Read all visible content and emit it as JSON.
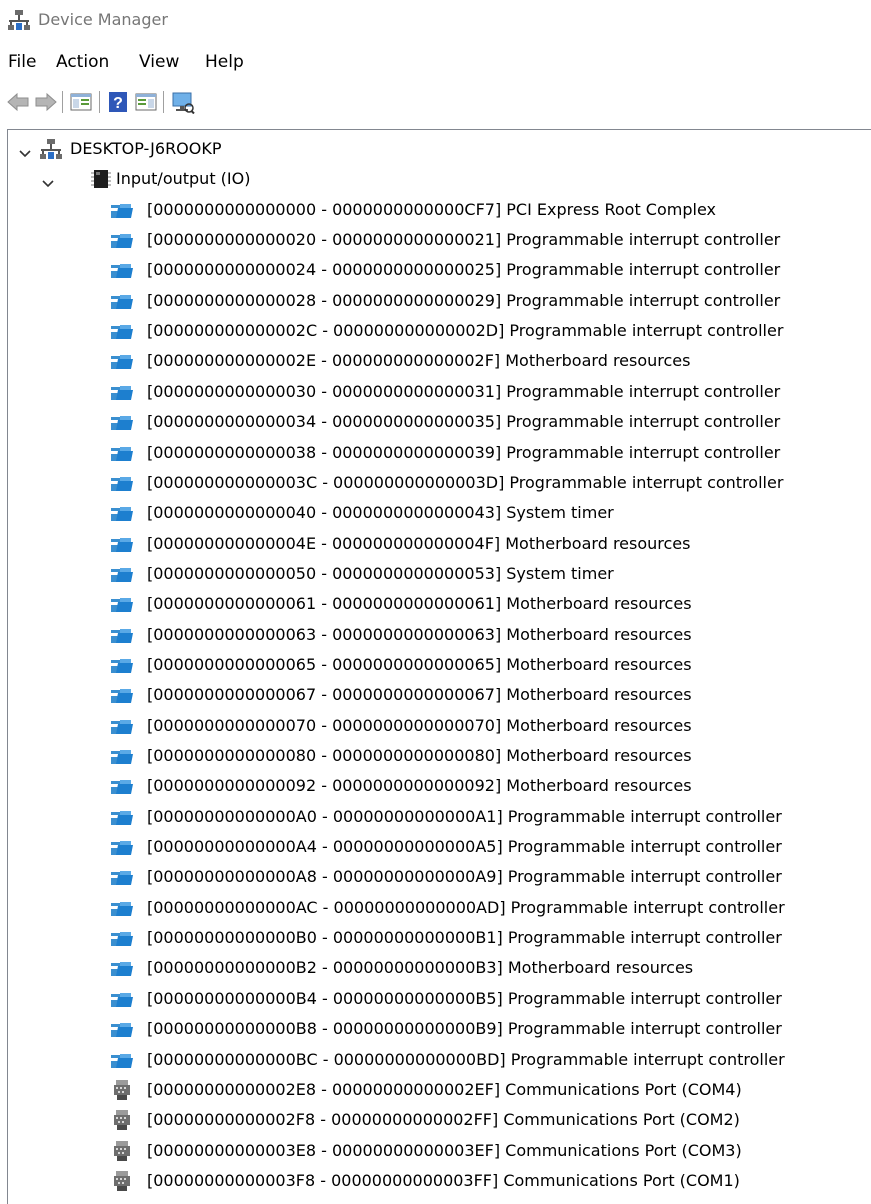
{
  "window": {
    "title": "Device Manager"
  },
  "menu": [
    "File",
    "Action",
    "View",
    "Help"
  ],
  "toolbar": [
    "back-icon",
    "forward-icon",
    "show-hide-console-tree-icon",
    "help-icon",
    "properties-icon",
    "scan-hardware-icon"
  ],
  "tree": {
    "root": {
      "label": "DESKTOP-J6ROOKP",
      "icon": "computer-icon",
      "expanded": true
    },
    "category": {
      "label": "Input/output (IO)",
      "icon": "io-chip-icon",
      "expanded": true
    },
    "items": [
      {
        "label": "[0000000000000000 - 0000000000000CF7]  PCI Express Root Complex",
        "icon": "io-folder-icon"
      },
      {
        "label": "[0000000000000020 - 0000000000000021]  Programmable interrupt controller",
        "icon": "io-folder-icon"
      },
      {
        "label": "[0000000000000024 - 0000000000000025]  Programmable interrupt controller",
        "icon": "io-folder-icon"
      },
      {
        "label": "[0000000000000028 - 0000000000000029]  Programmable interrupt controller",
        "icon": "io-folder-icon"
      },
      {
        "label": "[000000000000002C - 000000000000002D]  Programmable interrupt controller",
        "icon": "io-folder-icon"
      },
      {
        "label": "[000000000000002E - 000000000000002F]  Motherboard resources",
        "icon": "io-folder-icon"
      },
      {
        "label": "[0000000000000030 - 0000000000000031]  Programmable interrupt controller",
        "icon": "io-folder-icon"
      },
      {
        "label": "[0000000000000034 - 0000000000000035]  Programmable interrupt controller",
        "icon": "io-folder-icon"
      },
      {
        "label": "[0000000000000038 - 0000000000000039]  Programmable interrupt controller",
        "icon": "io-folder-icon"
      },
      {
        "label": "[000000000000003C - 000000000000003D]  Programmable interrupt controller",
        "icon": "io-folder-icon"
      },
      {
        "label": "[0000000000000040 - 0000000000000043]  System timer",
        "icon": "io-folder-icon"
      },
      {
        "label": "[000000000000004E - 000000000000004F]  Motherboard resources",
        "icon": "io-folder-icon"
      },
      {
        "label": "[0000000000000050 - 0000000000000053]  System timer",
        "icon": "io-folder-icon"
      },
      {
        "label": "[0000000000000061 - 0000000000000061]  Motherboard resources",
        "icon": "io-folder-icon"
      },
      {
        "label": "[0000000000000063 - 0000000000000063]  Motherboard resources",
        "icon": "io-folder-icon"
      },
      {
        "label": "[0000000000000065 - 0000000000000065]  Motherboard resources",
        "icon": "io-folder-icon"
      },
      {
        "label": "[0000000000000067 - 0000000000000067]  Motherboard resources",
        "icon": "io-folder-icon"
      },
      {
        "label": "[0000000000000070 - 0000000000000070]  Motherboard resources",
        "icon": "io-folder-icon"
      },
      {
        "label": "[0000000000000080 - 0000000000000080]  Motherboard resources",
        "icon": "io-folder-icon"
      },
      {
        "label": "[0000000000000092 - 0000000000000092]  Motherboard resources",
        "icon": "io-folder-icon"
      },
      {
        "label": "[00000000000000A0 - 00000000000000A1]  Programmable interrupt controller",
        "icon": "io-folder-icon"
      },
      {
        "label": "[00000000000000A4 - 00000000000000A5]  Programmable interrupt controller",
        "icon": "io-folder-icon"
      },
      {
        "label": "[00000000000000A8 - 00000000000000A9]  Programmable interrupt controller",
        "icon": "io-folder-icon"
      },
      {
        "label": "[00000000000000AC - 00000000000000AD]  Programmable interrupt controller",
        "icon": "io-folder-icon"
      },
      {
        "label": "[00000000000000B0 - 00000000000000B1]  Programmable interrupt controller",
        "icon": "io-folder-icon"
      },
      {
        "label": "[00000000000000B2 - 00000000000000B3]  Motherboard resources",
        "icon": "io-folder-icon"
      },
      {
        "label": "[00000000000000B4 - 00000000000000B5]  Programmable interrupt controller",
        "icon": "io-folder-icon"
      },
      {
        "label": "[00000000000000B8 - 00000000000000B9]  Programmable interrupt controller",
        "icon": "io-folder-icon"
      },
      {
        "label": "[00000000000000BC - 00000000000000BD]  Programmable interrupt controller",
        "icon": "io-folder-icon"
      },
      {
        "label": "[00000000000002E8 - 00000000000002EF]  Communications Port (COM4)",
        "icon": "com-port-icon"
      },
      {
        "label": "[00000000000002F8 - 00000000000002FF]  Communications Port (COM2)",
        "icon": "com-port-icon"
      },
      {
        "label": "[00000000000003E8 - 00000000000003EF]  Communications Port (COM3)",
        "icon": "com-port-icon"
      },
      {
        "label": "[00000000000003F8 - 00000000000003FF]  Communications Port (COM1)",
        "icon": "com-port-icon"
      }
    ]
  }
}
